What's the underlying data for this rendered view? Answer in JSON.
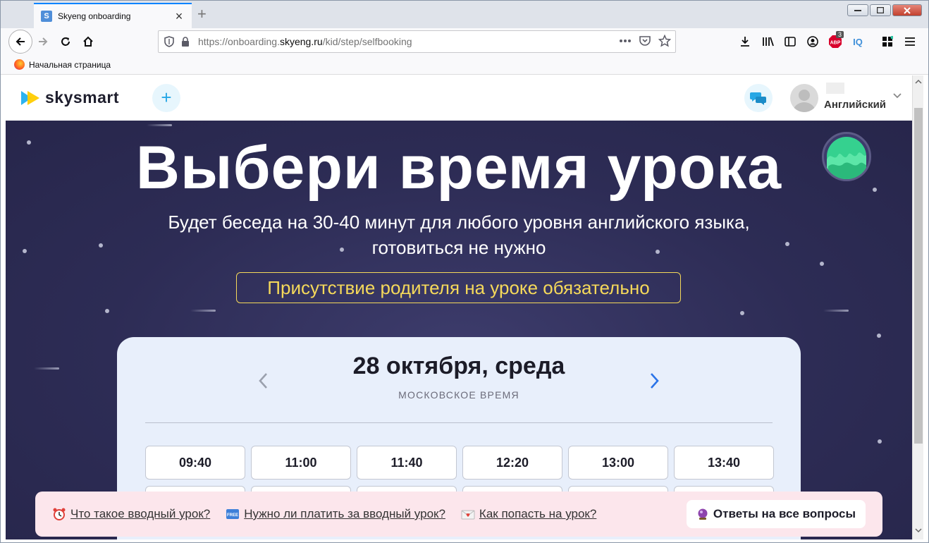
{
  "browser": {
    "tab_title": "Skyeng onboarding",
    "tab_favicon_letter": "S",
    "new_tab_symbol": "+",
    "close_tab_symbol": "×",
    "url_prefix": "https://onboarding.",
    "url_domain": "skyeng.ru",
    "url_path": "/kid/step/selfbooking",
    "bookmark_label": "Начальная страница",
    "abp_badge": "3",
    "iq_label": "IQ",
    "window_buttons": [
      "minimize",
      "maximize",
      "close"
    ]
  },
  "header": {
    "logo_text": "skysmart",
    "plus_label": "+",
    "user_subject": "Английский"
  },
  "hero": {
    "title": "Выбери время урока",
    "subtitle_line1": "Будет беседа на 30-40 минут для любого уровня английского языка,",
    "subtitle_line2": "готовиться не нужно",
    "notice": "Присутствие родителя на уроке обязательно"
  },
  "schedule": {
    "date_label": "28 октября, среда",
    "timezone_label": "МОСКОВСКОЕ ВРЕМЯ",
    "slots": [
      "09:40",
      "11:00",
      "11:40",
      "12:20",
      "13:00",
      "13:40"
    ]
  },
  "faq": {
    "items": [
      {
        "icon": "alarm-clock-icon",
        "label": "Что такое вводный урок?"
      },
      {
        "icon": "free-badge-icon",
        "label": "Нужно ли платить за вводный урок?"
      },
      {
        "icon": "envelope-heart-icon",
        "label": "Как попасть на урок?"
      }
    ],
    "all_answers_label": "Ответы на все вопросы"
  },
  "colors": {
    "hero_bg": "#2d2c55",
    "notice_yellow": "#f5d95a",
    "accent_blue": "#26a7e5",
    "card_bg": "#e8effb",
    "faq_bg": "#fce6ec"
  }
}
